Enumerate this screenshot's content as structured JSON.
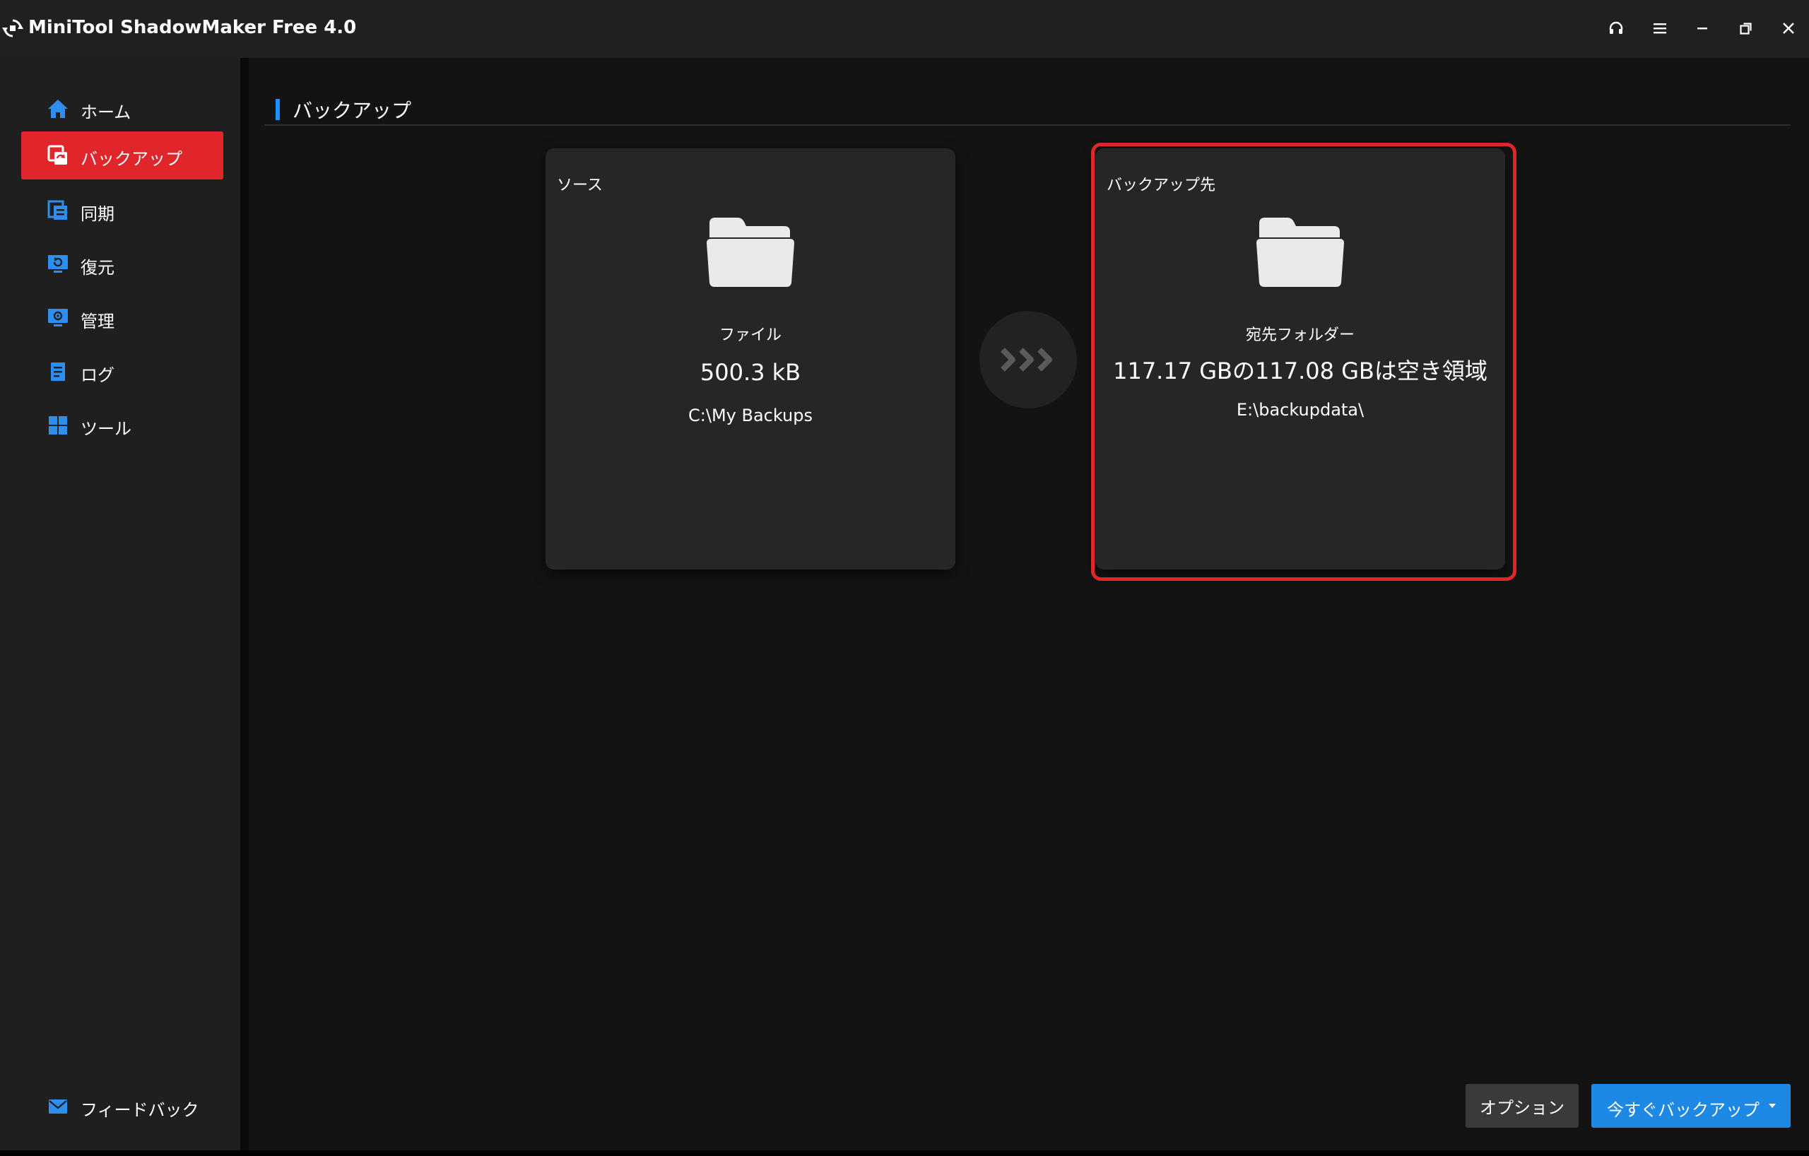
{
  "window": {
    "title": "MiniTool ShadowMaker Free 4.0",
    "controls": [
      {
        "name": "headset-icon"
      },
      {
        "name": "menu-icon"
      },
      {
        "name": "minimize-icon"
      },
      {
        "name": "restore-icon"
      },
      {
        "name": "close-icon"
      }
    ]
  },
  "sidebar": {
    "items": [
      {
        "label": "ホーム",
        "icon": "home-icon"
      },
      {
        "label": "バックアップ",
        "icon": "backup-icon",
        "active": true
      },
      {
        "label": "同期",
        "icon": "sync-icon"
      },
      {
        "label": "復元",
        "icon": "restore-icon"
      },
      {
        "label": "管理",
        "icon": "manage-icon"
      },
      {
        "label": "ログ",
        "icon": "log-icon"
      },
      {
        "label": "ツール",
        "icon": "tools-icon"
      }
    ],
    "feedback": {
      "label": "フィードバック",
      "icon": "mail-icon"
    }
  },
  "main": {
    "section_title": "バックアップ",
    "source": {
      "label": "ソース",
      "type": "ファイル",
      "size": "500.3 kB",
      "path": "C:\\My Backups"
    },
    "destination": {
      "label": "バックアップ先",
      "type": "宛先フォルダー",
      "space": "117.17 GBの117.08 GBは空き領域",
      "path": "E:\\backupdata\\"
    },
    "buttons": {
      "options": "オプション",
      "backup_now": "今すぐバックアップ"
    }
  },
  "colors": {
    "accent_red": "#e0262b",
    "accent_blue": "#1e88e5",
    "icon_blue": "#2f8ff0",
    "background": "#131313",
    "card": "#262626"
  }
}
